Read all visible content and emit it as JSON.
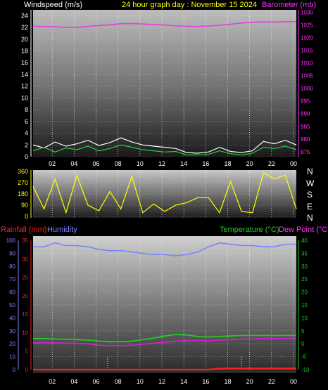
{
  "header": {
    "left": "Windspeed (m/s)",
    "center": "24 hour graph day : November 15 2024",
    "right": "Barometer (mb)"
  },
  "compass": [
    "N",
    "W",
    "S",
    "E",
    "N"
  ],
  "lower_header": {
    "rain": "Rainfall (mm)",
    "humidity": "Humidity",
    "temperature": "Temperature (°C)",
    "dewpoint": "Dew Point (°C)"
  },
  "colors": {
    "wind": "#ffffff",
    "gust_base": "#2ecc40",
    "pressure": "#e040e0",
    "direction": "#ffff00",
    "humidity": "#7b84ff",
    "temperature": "#22cc22",
    "dewpoint": "#cc22cc",
    "rain": "#ff2020",
    "text_yellow": "#ffff00",
    "text_blue": "#7b84ff",
    "text_green": "#22cc22",
    "text_pink": "#ff33ff",
    "text_red": "#ff2020",
    "text_white": "#ffffff"
  },
  "chart_data": [
    {
      "type": "line",
      "id": "wind-pressure",
      "x_ticks": [
        "02",
        "04",
        "06",
        "08",
        "10",
        "12",
        "14",
        "16",
        "18",
        "20",
        "22",
        "00"
      ],
      "y_left": {
        "label": "Windspeed (m/s)",
        "ticks": [
          0,
          2,
          4,
          6,
          8,
          10,
          12,
          14,
          16,
          18,
          20,
          22,
          24
        ],
        "range": [
          0,
          25
        ]
      },
      "y_right": {
        "label": "Barometer (mb)",
        "ticks": [
          975,
          980,
          985,
          990,
          995,
          1000,
          1005,
          1010,
          1015,
          1020,
          1025,
          1030
        ],
        "range": [
          973,
          1031
        ]
      },
      "series": [
        {
          "name": "Barometer (mb)",
          "axis": "right",
          "x": [
            0,
            1,
            2,
            3,
            4,
            5,
            6,
            7,
            8,
            9,
            10,
            11,
            12,
            13,
            14,
            15,
            16,
            17,
            18,
            19,
            20,
            21,
            22,
            23,
            24
          ],
          "values": [
            1024.5,
            1024.4,
            1024.3,
            1024.1,
            1024.1,
            1024.4,
            1024.8,
            1025.1,
            1025.5,
            1025.6,
            1025.4,
            1025.2,
            1025.0,
            1024.7,
            1024.5,
            1024.4,
            1024.6,
            1024.9,
            1025.3,
            1025.8,
            1026.1,
            1026.2,
            1026.2,
            1026.3,
            1026.3
          ]
        },
        {
          "name": "Windspeed (m/s)",
          "axis": "left",
          "x": [
            0,
            1,
            2,
            3,
            4,
            5,
            6,
            7,
            8,
            9,
            10,
            11,
            12,
            13,
            14,
            15,
            16,
            17,
            18,
            19,
            20,
            21,
            22,
            23,
            24
          ],
          "values": [
            1.0,
            1.6,
            0.8,
            1.5,
            1.2,
            1.8,
            1.0,
            1.4,
            2.0,
            1.6,
            1.2,
            1.0,
            0.8,
            0.9,
            0.3,
            0.3,
            0.4,
            1.0,
            0.5,
            0.3,
            0.6,
            1.6,
            1.4,
            1.8,
            1.2
          ]
        },
        {
          "name": "gust",
          "axis": "left",
          "x": [
            0,
            1,
            2,
            3,
            4,
            5,
            6,
            7,
            8,
            9,
            10,
            11,
            12,
            13,
            14,
            15,
            16,
            17,
            18,
            19,
            20,
            21,
            22,
            23,
            24
          ],
          "values": [
            2.0,
            1.5,
            2.5,
            1.8,
            2.2,
            2.8,
            1.9,
            2.4,
            3.2,
            2.5,
            2.0,
            1.8,
            1.6,
            1.4,
            0.7,
            0.6,
            0.8,
            1.6,
            0.9,
            0.7,
            1.0,
            2.6,
            2.2,
            2.8,
            2.0
          ]
        }
      ]
    },
    {
      "type": "line",
      "id": "wind-direction",
      "x_ticks": [
        "02",
        "04",
        "06",
        "08",
        "10",
        "12",
        "14",
        "16",
        "18",
        "20",
        "22",
        "00"
      ],
      "y_left": {
        "ticks": [
          0,
          90,
          180,
          270,
          360
        ],
        "range": [
          0,
          360
        ]
      },
      "series": [
        {
          "name": "direction",
          "x": [
            0,
            1,
            2,
            3,
            4,
            5,
            6,
            7,
            8,
            9,
            10,
            11,
            12,
            13,
            14,
            15,
            16,
            17,
            18,
            19,
            20,
            21,
            22,
            23,
            24
          ],
          "values": [
            240,
            60,
            300,
            30,
            330,
            90,
            45,
            200,
            60,
            320,
            30,
            100,
            40,
            90,
            110,
            150,
            150,
            30,
            280,
            40,
            30,
            350,
            300,
            330,
            60
          ]
        }
      ]
    },
    {
      "type": "line",
      "id": "temp-hum-rain",
      "x_ticks": [
        "02",
        "04",
        "06",
        "08",
        "10",
        "12",
        "14",
        "16",
        "18",
        "20",
        "22",
        "00"
      ],
      "y_hum": {
        "label": "Humidity",
        "ticks": [
          0,
          10,
          20,
          30,
          40,
          50,
          60,
          70,
          80,
          90,
          100
        ],
        "range": [
          0,
          100
        ]
      },
      "y_rain": {
        "label": "Rainfall (mm)",
        "ticks": [
          0,
          5,
          10,
          15,
          20,
          25,
          30,
          35
        ],
        "range": [
          0,
          35
        ]
      },
      "y_temp": {
        "label": "Temperature (°C)",
        "ticks": [
          -10,
          -5,
          0,
          5,
          10,
          15,
          20,
          25,
          30,
          35,
          40
        ],
        "range": [
          -10,
          40
        ]
      },
      "series": [
        {
          "name": "Humidity",
          "axis": "hum",
          "x": [
            0,
            1,
            2,
            3,
            4,
            5,
            6,
            7,
            8,
            9,
            10,
            11,
            12,
            13,
            14,
            15,
            16,
            17,
            18,
            19,
            20,
            21,
            22,
            23,
            24
          ],
          "values": [
            95,
            95,
            98,
            96,
            96,
            95,
            93,
            92,
            92,
            91,
            90,
            89,
            89,
            88,
            89,
            91,
            95,
            98,
            97,
            96,
            96,
            95,
            95,
            97,
            97
          ]
        },
        {
          "name": "Temperature (°C)",
          "axis": "temp",
          "x": [
            0,
            1,
            2,
            3,
            4,
            5,
            6,
            7,
            8,
            9,
            10,
            11,
            12,
            13,
            14,
            15,
            16,
            17,
            18,
            19,
            20,
            21,
            22,
            23,
            24
          ],
          "values": [
            2.0,
            2.0,
            1.8,
            1.8,
            1.6,
            1.4,
            1.0,
            0.8,
            0.8,
            1.0,
            1.6,
            2.2,
            3.0,
            3.6,
            3.4,
            2.8,
            2.6,
            2.8,
            3.0,
            3.2,
            3.2,
            3.2,
            3.2,
            3.2,
            3.2
          ]
        },
        {
          "name": "Dew Point (°C)",
          "axis": "temp",
          "x": [
            0,
            1,
            2,
            3,
            4,
            5,
            6,
            7,
            8,
            9,
            10,
            11,
            12,
            13,
            14,
            15,
            16,
            17,
            18,
            19,
            20,
            21,
            22,
            23,
            24
          ],
          "values": [
            0.4,
            0.4,
            0.4,
            0.2,
            0.2,
            0.0,
            -0.6,
            -0.8,
            -0.8,
            -0.6,
            -0.2,
            0.2,
            0.6,
            1.0,
            1.2,
            1.2,
            1.2,
            1.4,
            1.6,
            1.8,
            1.8,
            2.0,
            2.0,
            2.0,
            2.0
          ]
        },
        {
          "name": "Rainfall (mm)",
          "axis": "rain",
          "x": [
            0,
            1,
            2,
            3,
            4,
            5,
            6,
            7,
            8,
            9,
            10,
            11,
            12,
            13,
            14,
            15,
            16,
            17,
            18,
            19,
            20,
            21,
            22,
            23,
            24
          ],
          "values": [
            0,
            0,
            0,
            0,
            0,
            0,
            0,
            0,
            0,
            0,
            0,
            0,
            0,
            0,
            0,
            0,
            0,
            0.3,
            0.3,
            0.3,
            0.3,
            0.3,
            0.3,
            0.3,
            0.3
          ]
        }
      ]
    }
  ]
}
